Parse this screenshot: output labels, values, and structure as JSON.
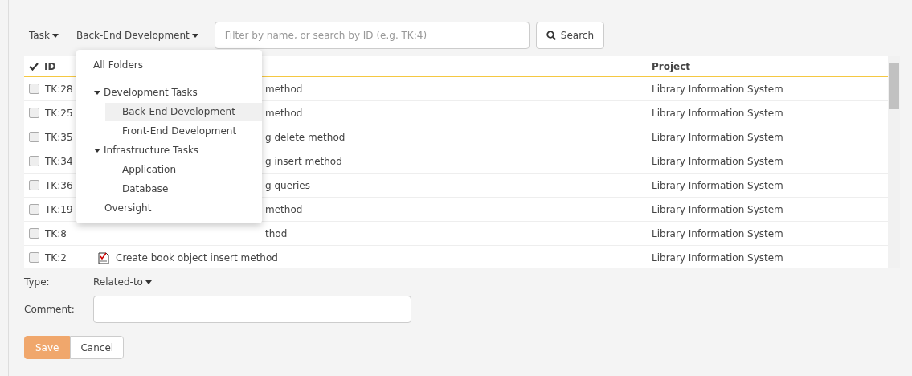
{
  "toolbar": {
    "type_menu": "Task",
    "folder_menu": "Back-End Development",
    "search": {
      "placeholder": "Filter by name, or search by ID (e.g. TK:4)"
    },
    "search_button": "Search"
  },
  "folder_dropdown": {
    "items": [
      {
        "label": "All Folders",
        "selected": false,
        "expanded": false
      },
      {
        "label": "Development Tasks",
        "selected": false,
        "expanded": true,
        "children": [
          {
            "label": "Back-End Development",
            "selected": true
          },
          {
            "label": "Front-End Development",
            "selected": false
          }
        ]
      },
      {
        "label": "Infrastructure Tasks",
        "selected": false,
        "expanded": true,
        "children": [
          {
            "label": "Application",
            "selected": false
          },
          {
            "label": "Database",
            "selected": false
          }
        ]
      },
      {
        "label": "Oversight",
        "selected": false,
        "expanded": false
      }
    ]
  },
  "table": {
    "columns": [
      "ID",
      "Project"
    ],
    "rows": [
      {
        "id": "TK:28",
        "kind": "covered",
        "name": "method",
        "project": "Library Information System",
        "checked": false
      },
      {
        "id": "TK:25",
        "kind": "covered",
        "name": "method",
        "project": "Library Information System",
        "checked": false
      },
      {
        "id": "TK:35",
        "kind": "covered",
        "name": "g delete method",
        "project": "Library Information System",
        "checked": false
      },
      {
        "id": "TK:34",
        "kind": "covered",
        "name": "g insert method",
        "project": "Library Information System",
        "checked": false
      },
      {
        "id": "TK:36",
        "kind": "covered",
        "name": "g queries",
        "project": "Library Information System",
        "checked": false
      },
      {
        "id": "TK:19",
        "kind": "covered",
        "name": "method",
        "project": "Library Information System",
        "checked": false
      },
      {
        "id": "TK:8",
        "kind": "covered",
        "name": "thod",
        "project": "Library Information System",
        "checked": false
      },
      {
        "id": "TK:2",
        "kind": "full",
        "name": "Create book object insert method",
        "project": "Library Information System",
        "checked": false
      }
    ]
  },
  "form": {
    "type_label": "Type:",
    "type_value": "Related-to",
    "comment_label": "Comment:",
    "save": "Save",
    "cancel": "Cancel"
  }
}
